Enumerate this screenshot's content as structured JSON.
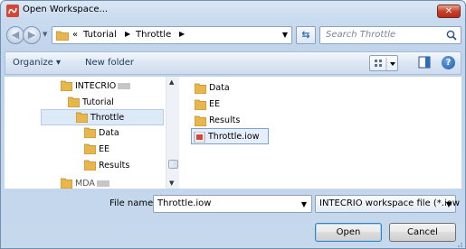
{
  "window": {
    "title": "Open Workspace..."
  },
  "address_bar": {
    "overflow": "«",
    "crumbs": [
      "Tutorial",
      "Throttle"
    ],
    "search_placeholder": "Search Throttle"
  },
  "toolbar": {
    "organize_label": "Organize ▾",
    "new_folder_label": "New folder"
  },
  "nav_tree": {
    "items": [
      {
        "label": "INTECRIO",
        "level": 1
      },
      {
        "label": "Tutorial",
        "level": 2
      },
      {
        "label": "Throttle",
        "level": 3,
        "selected": true
      },
      {
        "label": "Data",
        "level": 4
      },
      {
        "label": "EE",
        "level": 4
      },
      {
        "label": "Results",
        "level": 4
      },
      {
        "label": "MDA",
        "level": 1
      }
    ]
  },
  "file_list": {
    "items": [
      {
        "label": "Data",
        "type": "folder"
      },
      {
        "label": "EE",
        "type": "folder"
      },
      {
        "label": "Results",
        "type": "folder"
      },
      {
        "label": "Throttle.iow",
        "type": "file",
        "selected": true
      }
    ]
  },
  "footer": {
    "file_name_label": "File name:",
    "file_name_value": "Throttle.iow",
    "file_type_value": "INTECRIO workspace file (*.iow",
    "open_label": "Open",
    "cancel_label": "Cancel"
  },
  "colors": {
    "folder": "#e8b64a",
    "selection": "#dce9f7",
    "accent": "#1c5aad"
  }
}
